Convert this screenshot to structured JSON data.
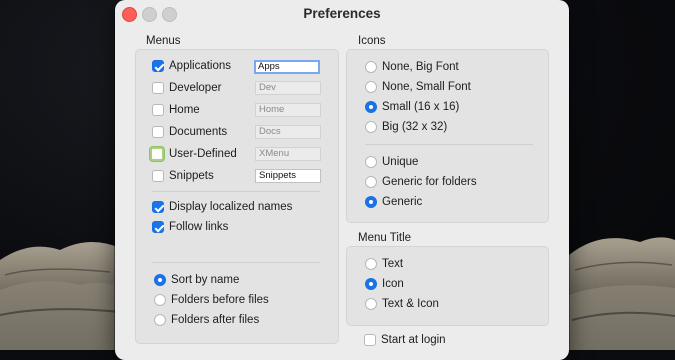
{
  "window": {
    "title": "Preferences"
  },
  "menus": {
    "title": "Menus",
    "items": [
      {
        "label": "Applications",
        "checked": true,
        "field": "Apps"
      },
      {
        "label": "Developer",
        "checked": false,
        "field": "Dev"
      },
      {
        "label": "Home",
        "checked": false,
        "field": "Home"
      },
      {
        "label": "Documents",
        "checked": false,
        "field": "Docs"
      },
      {
        "label": "User-Defined",
        "checked": false,
        "field": "XMenu"
      },
      {
        "label": "Snippets",
        "checked": false,
        "field": "Snippets"
      }
    ],
    "options": [
      {
        "label": "Display localized names",
        "checked": true
      },
      {
        "label": "Follow links",
        "checked": true
      }
    ],
    "sort": [
      {
        "label": "Sort by name",
        "selected": true
      },
      {
        "label": "Folders before files",
        "selected": false
      },
      {
        "label": "Folders after files",
        "selected": false
      }
    ]
  },
  "icons": {
    "title": "Icons",
    "size": [
      {
        "label": "None, Big Font",
        "selected": false
      },
      {
        "label": "None, Small Font",
        "selected": false
      },
      {
        "label": "Small (16 x 16)",
        "selected": true
      },
      {
        "label": "Big (32 x 32)",
        "selected": false
      }
    ],
    "type": [
      {
        "label": "Unique",
        "selected": false
      },
      {
        "label": "Generic for folders",
        "selected": false
      },
      {
        "label": "Generic",
        "selected": true
      }
    ]
  },
  "menu_title": {
    "title": "Menu Title",
    "options": [
      {
        "label": "Text",
        "selected": false
      },
      {
        "label": "Icon",
        "selected": true
      },
      {
        "label": "Text & Icon",
        "selected": false
      }
    ]
  },
  "start_at_login": {
    "label": "Start at login",
    "checked": false
  },
  "colors": {
    "accent": "#1a73e8",
    "close": "#ff5f57"
  }
}
